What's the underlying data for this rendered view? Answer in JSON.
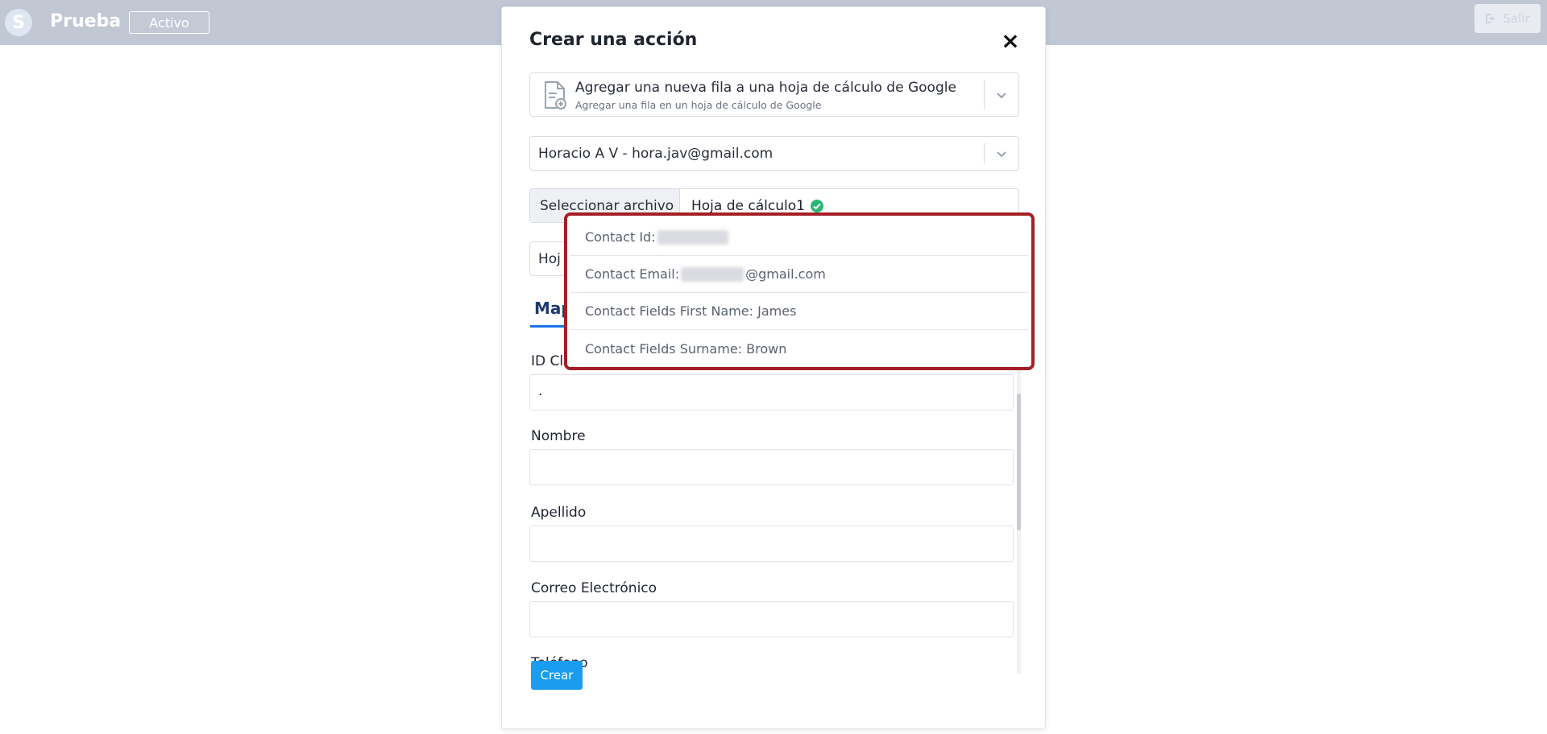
{
  "app": {
    "logo_letter": "S",
    "name": "Prueba",
    "status_badge": "Activo",
    "logout_label": "Salir"
  },
  "modal": {
    "title": "Crear una acción",
    "close_glyph": "×",
    "action_select": {
      "main": "Agregar una nueva fila a una hoja de cálculo de Google",
      "sub": "Agregar una fila en un hoja de cálculo de Google"
    },
    "account_select": "Horacio A V - hora.jav@gmail.com",
    "file_button": "Seleccionar archivo",
    "file_name": "Hoja de cálculo1",
    "sheet_select": "Hoj",
    "tab_label": "Map",
    "fields": [
      {
        "label": "ID Cl",
        "value": "."
      },
      {
        "label": "Nombre",
        "value": ""
      },
      {
        "label": "Apellido",
        "value": ""
      },
      {
        "label": "Correo Electrónico",
        "value": ""
      },
      {
        "label": "Teléfono",
        "value": ""
      }
    ],
    "create_button": "Crear"
  },
  "dropdown": {
    "items": [
      {
        "prefix": "Contact Id:",
        "suffix": ""
      },
      {
        "prefix": "Contact Email:",
        "suffix": "@gmail.com"
      },
      {
        "prefix": "Contact Fields First Name: James",
        "suffix": ""
      },
      {
        "prefix": "Contact Fields Surname: Brown",
        "suffix": ""
      }
    ],
    "highlight_color": "#a31f25"
  },
  "icons": {
    "close": "close-icon",
    "chevron": "chevron-down-icon",
    "document": "document-add-icon",
    "check": "check-circle-icon",
    "logout": "logout-icon"
  }
}
